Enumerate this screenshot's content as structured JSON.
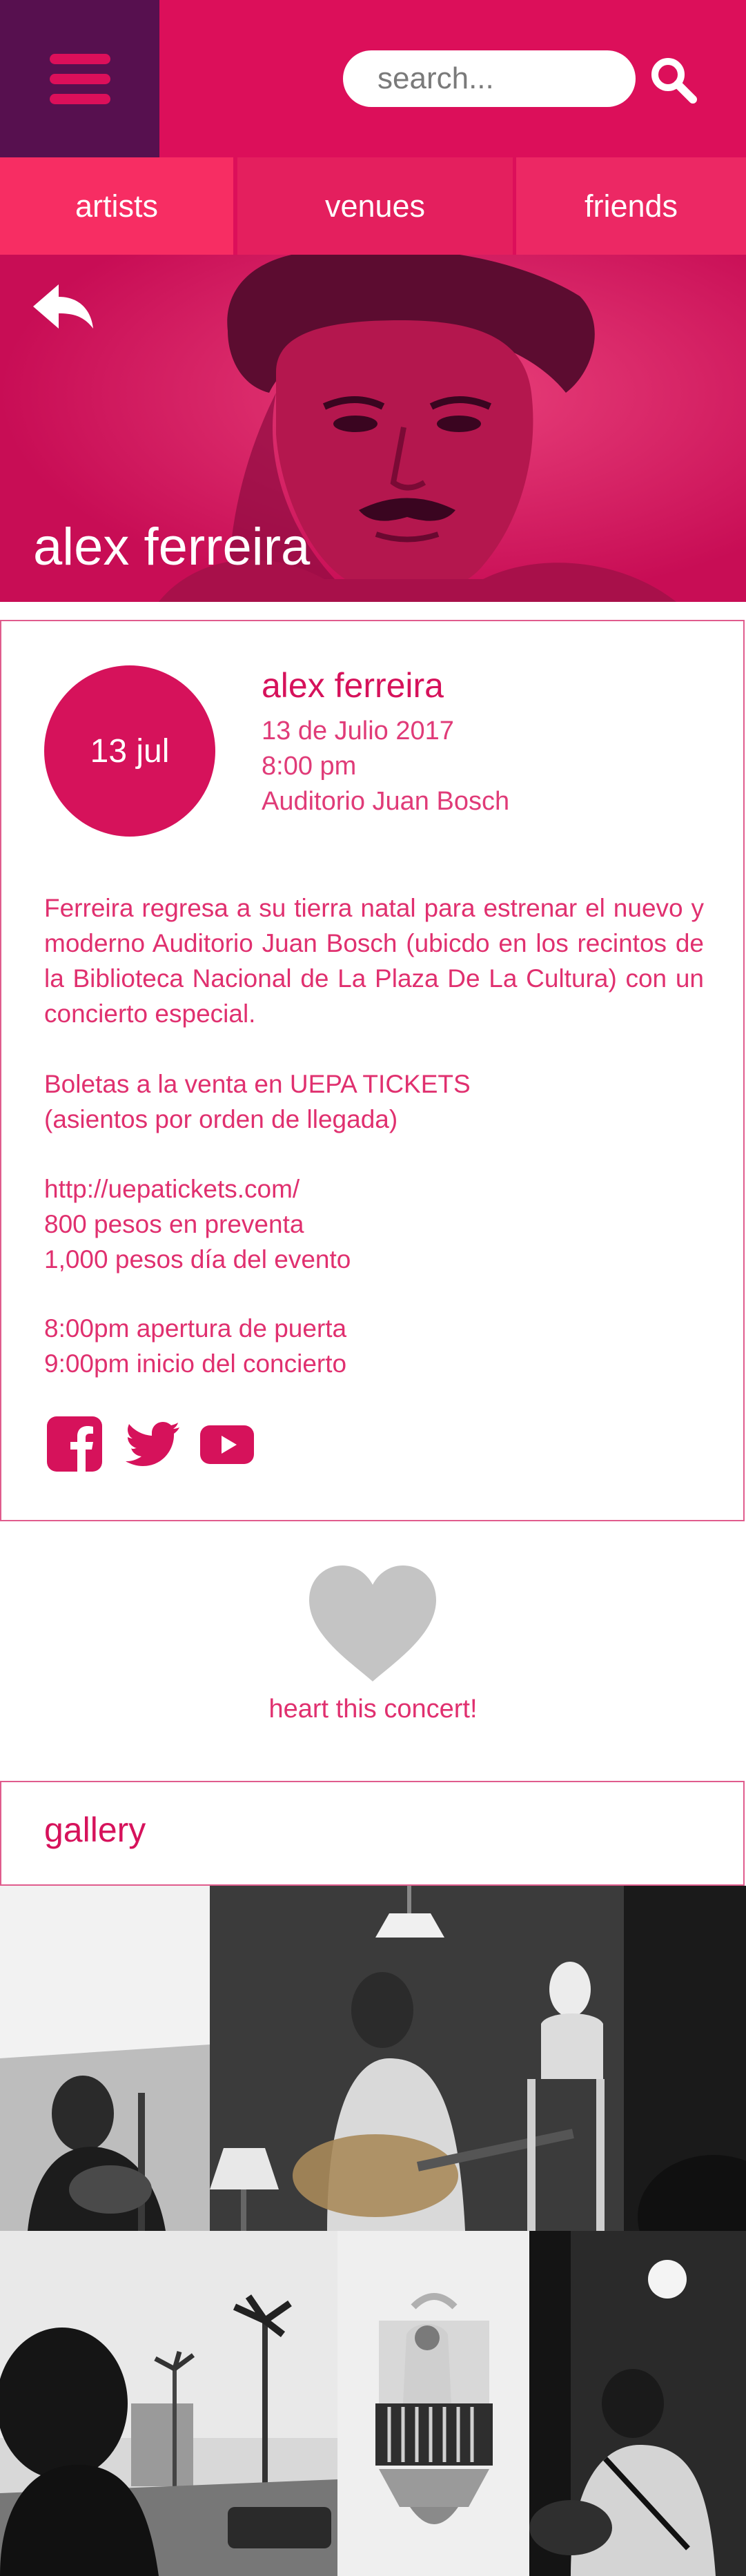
{
  "header": {
    "menu_icon": "hamburger-icon",
    "search_placeholder": "search...",
    "search_icon": "search-icon"
  },
  "tabs": [
    {
      "label": "artists"
    },
    {
      "label": "venues"
    },
    {
      "label": "friends"
    }
  ],
  "hero": {
    "back_icon": "back-arrow-icon",
    "title": "alex ferreira"
  },
  "event": {
    "date_badge": "13 jul",
    "name": "alex ferreira",
    "date": "13 de Julio 2017",
    "time": "8:00 pm",
    "venue": "Auditorio Juan Bosch",
    "description": "Ferreira regresa a su tierra natal para estrenar el nuevo y moderno Auditorio Juan Bosch (ubicdo en los recintos de la Biblioteca Nacional de La Plaza De La Cultura) con un concierto especial.",
    "tickets": [
      "Boletas a la venta en UEPA TICKETS",
      "(asientos por orden de llegada)"
    ],
    "prices": [
      "http://uepatickets.com/",
      "800 pesos en preventa",
      "1,000 pesos día del evento"
    ],
    "schedule": [
      "8:00pm apertura de puerta",
      "9:00pm inicio del concierto"
    ],
    "social": [
      "facebook-icon",
      "twitter-icon",
      "youtube-icon"
    ]
  },
  "heart": {
    "icon": "heart-icon",
    "caption": "heart this concert!"
  },
  "gallery": {
    "title": "gallery",
    "photos": [
      "gallery-photo-1",
      "gallery-photo-2",
      "gallery-photo-3",
      "gallery-photo-4",
      "gallery-photo-5"
    ]
  },
  "colors": {
    "brand_pink": "#dc0f5a",
    "menu_purple": "#57104f",
    "tab_pink": "#f12c62",
    "text_pink": "#d6125b",
    "heart_gray": "#c4c4c4"
  }
}
